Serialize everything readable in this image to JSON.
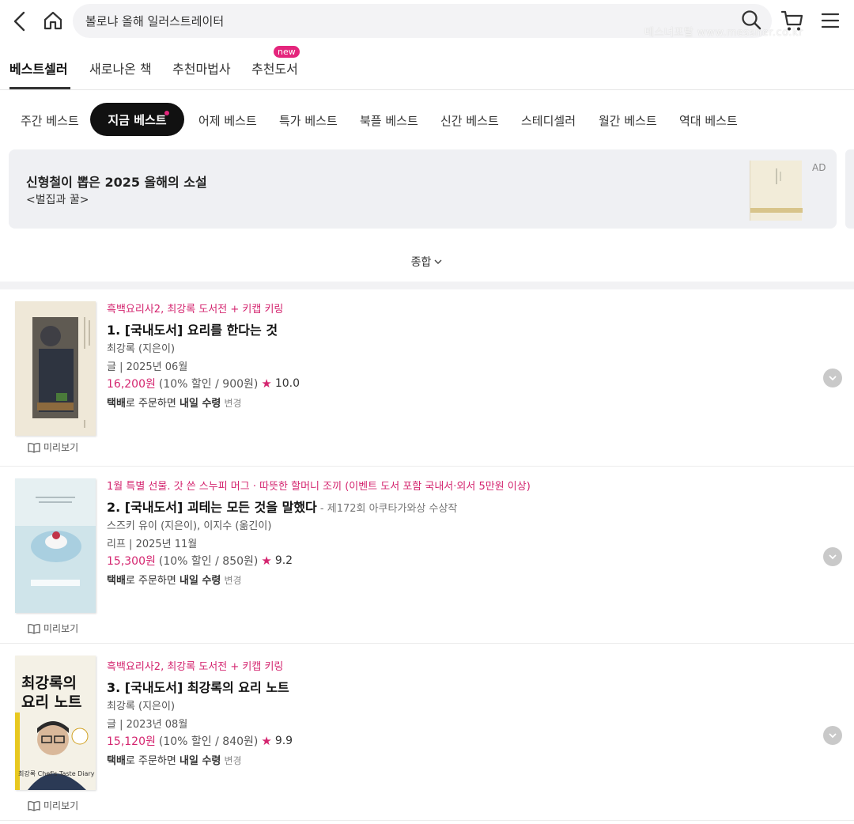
{
  "header": {
    "search_text": "볼로냐 올해 일러스트레이터",
    "watermark": "메스너포탈 www.messner.co.kr"
  },
  "main_tabs": [
    {
      "label": "베스트셀러",
      "active": true
    },
    {
      "label": "새로나온 책"
    },
    {
      "label": "추천마법사"
    },
    {
      "label": "추천도서",
      "badge": "new"
    }
  ],
  "sub_tabs": [
    {
      "label": "주간 베스트"
    },
    {
      "label": "지금 베스트",
      "active": true
    },
    {
      "label": "어제 베스트"
    },
    {
      "label": "특가 베스트"
    },
    {
      "label": "북플 베스트"
    },
    {
      "label": "신간 베스트"
    },
    {
      "label": "스테디셀러"
    },
    {
      "label": "월간 베스트"
    },
    {
      "label": "역대 베스트"
    }
  ],
  "ad": {
    "title": "신형철이 뽑은 2025 올해의 소설",
    "subtitle": "<벌집과 꿀>",
    "label": "AD"
  },
  "category": "종합",
  "preview_label": "미리보기",
  "books": [
    {
      "promo": "흑백요리사2, 최강록 도서전 + 키캡 키링",
      "title": "1. [국내도서] 요리를 한다는 것",
      "award": "",
      "authors": "최강록 (지은이)",
      "publisher_date": "글 | 2025년 06월",
      "price": "16,200원",
      "discount": "(10% 할인 / 900원)",
      "rating": "10.0",
      "delivery_prefix": "택배",
      "delivery_mid": "로 주문하면 ",
      "delivery_day": "내일 수령",
      "delivery_change": "변경"
    },
    {
      "promo": "1월 특별 선물. 갓 쓴 스누피 머그 · 따뜻한 할머니 조끼 (이벤트 도서 포함 국내서·외서 5만원 이상)",
      "title": "2. [국내도서] 괴테는 모든 것을 말했다",
      "award": " - 제172회 아쿠타가와상 수상작",
      "authors": "스즈키 유이 (지은이), 이지수 (옮긴이)",
      "publisher_date": "리프 | 2025년 11월",
      "price": "15,300원",
      "discount": "(10% 할인 / 850원)",
      "rating": "9.2",
      "delivery_prefix": "택배",
      "delivery_mid": "로 주문하면 ",
      "delivery_day": "내일 수령",
      "delivery_change": "변경"
    },
    {
      "promo": "흑백요리사2, 최강록 도서전 + 키캡 키링",
      "title": "3. [국내도서] 최강록의 요리 노트",
      "award": "",
      "authors": "최강록 (지은이)",
      "publisher_date": "글 | 2023년 08월",
      "price": "15,120원",
      "discount": "(10% 할인 / 840원)",
      "rating": "9.9",
      "delivery_prefix": "택배",
      "delivery_mid": "로 주문하면 ",
      "delivery_day": "내일 수령",
      "delivery_change": "변경"
    }
  ],
  "cover3_text": {
    "line1": "최강록의",
    "line2": "요리 노트",
    "footer": "최강록 Chef's Taste Diary"
  },
  "colors": {
    "accent": "#d4256f",
    "badge": "#e4257c",
    "active_tab_bg": "#111111"
  }
}
